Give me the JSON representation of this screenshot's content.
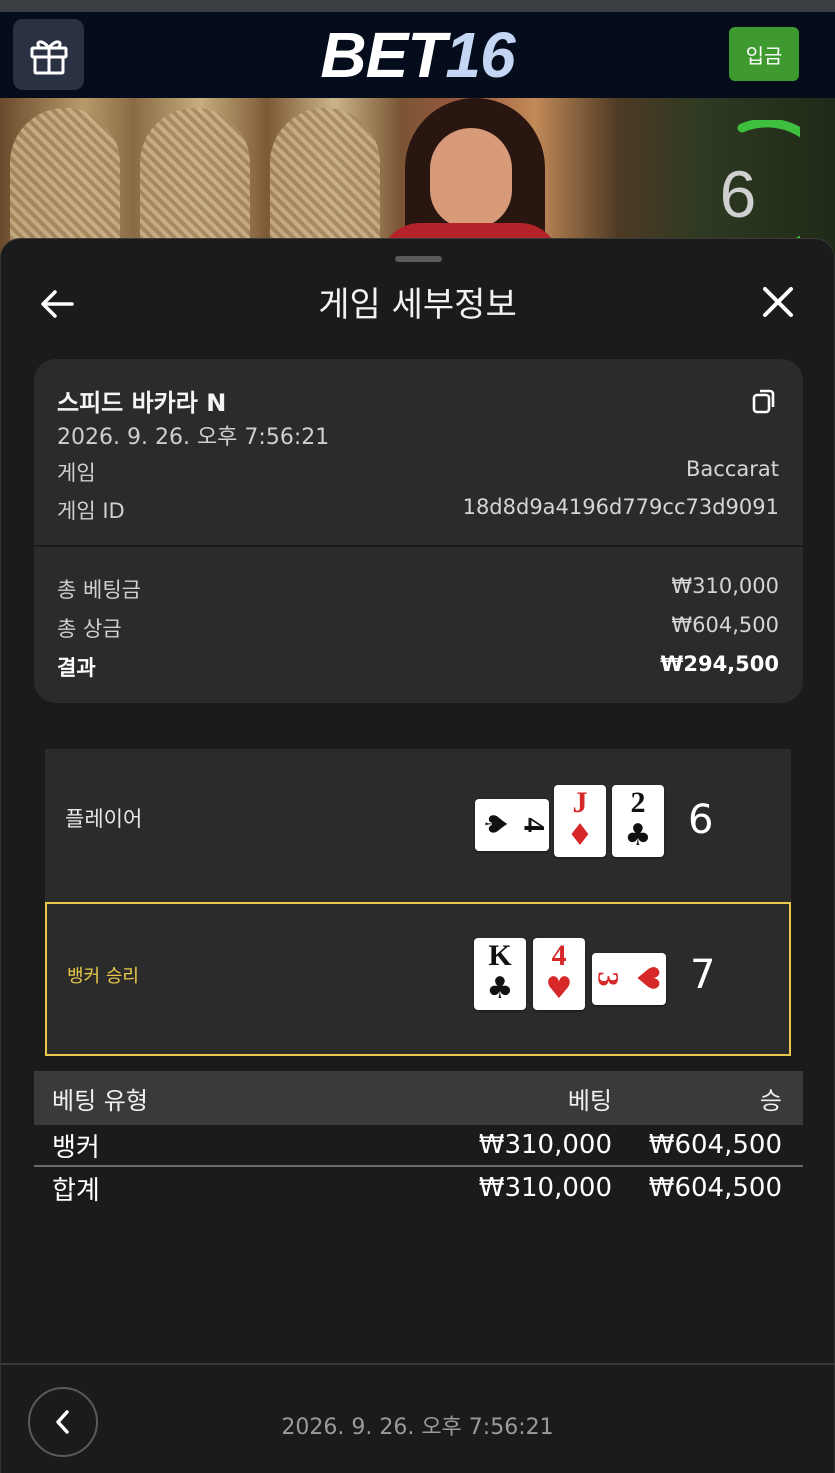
{
  "header": {
    "logo_main": "BET",
    "logo_num": "16",
    "deposit_label": "입금"
  },
  "video": {
    "countdown": "6"
  },
  "sheet": {
    "title": "게임 세부정보"
  },
  "game": {
    "name": "스피드 바카라 N",
    "datetime": "2026. 9. 26. 오후 7:56:21",
    "type_label": "게임",
    "type_value": "Baccarat",
    "id_label": "게임 ID",
    "id_value": "18d8d9a4196d779cc73d9091"
  },
  "summary": {
    "total_bet_label": "총 베팅금",
    "total_bet_value": "₩310,000",
    "total_win_label": "총 상금",
    "total_win_value": "₩604,500",
    "result_label": "결과",
    "result_value": "₩294,500"
  },
  "hands": {
    "player": {
      "label": "플레이어",
      "score": "6",
      "cards": [
        {
          "rank": "4",
          "suit": "♠",
          "color": "#111111",
          "orientation": "horizontal"
        },
        {
          "rank": "J",
          "suit": "♦",
          "color": "#d62828",
          "orientation": "vertical"
        },
        {
          "rank": "2",
          "suit": "♣",
          "color": "#111111",
          "orientation": "vertical"
        }
      ]
    },
    "banker": {
      "label": "뱅커 승리",
      "score": "7",
      "highlight_color": "#e9c84a",
      "cards": [
        {
          "rank": "K",
          "suit": "♣",
          "color": "#111111",
          "orientation": "vertical"
        },
        {
          "rank": "4",
          "suit": "♥",
          "color": "#d62828",
          "orientation": "vertical"
        },
        {
          "rank": "3",
          "suit": "♥",
          "color": "#d62828",
          "orientation": "horizontal"
        }
      ]
    }
  },
  "bets": {
    "headers": {
      "type": "베팅 유형",
      "bet": "베팅",
      "win": "승"
    },
    "rows": [
      {
        "type": "뱅커",
        "bet": "₩310,000",
        "win": "₩604,500"
      }
    ],
    "total": {
      "type": "합계",
      "bet": "₩310,000",
      "win": "₩604,500"
    }
  },
  "footer": {
    "datetime": "2026. 9. 26. 오후 7:56:21"
  },
  "colors": {
    "accent_green": "#3e9a2e",
    "banker_gold": "#e9c84a",
    "header_bg": "#050d1c"
  },
  "icons": [
    "gift-icon",
    "back-arrow-icon",
    "close-icon",
    "copy-icon",
    "chevron-left-icon"
  ]
}
